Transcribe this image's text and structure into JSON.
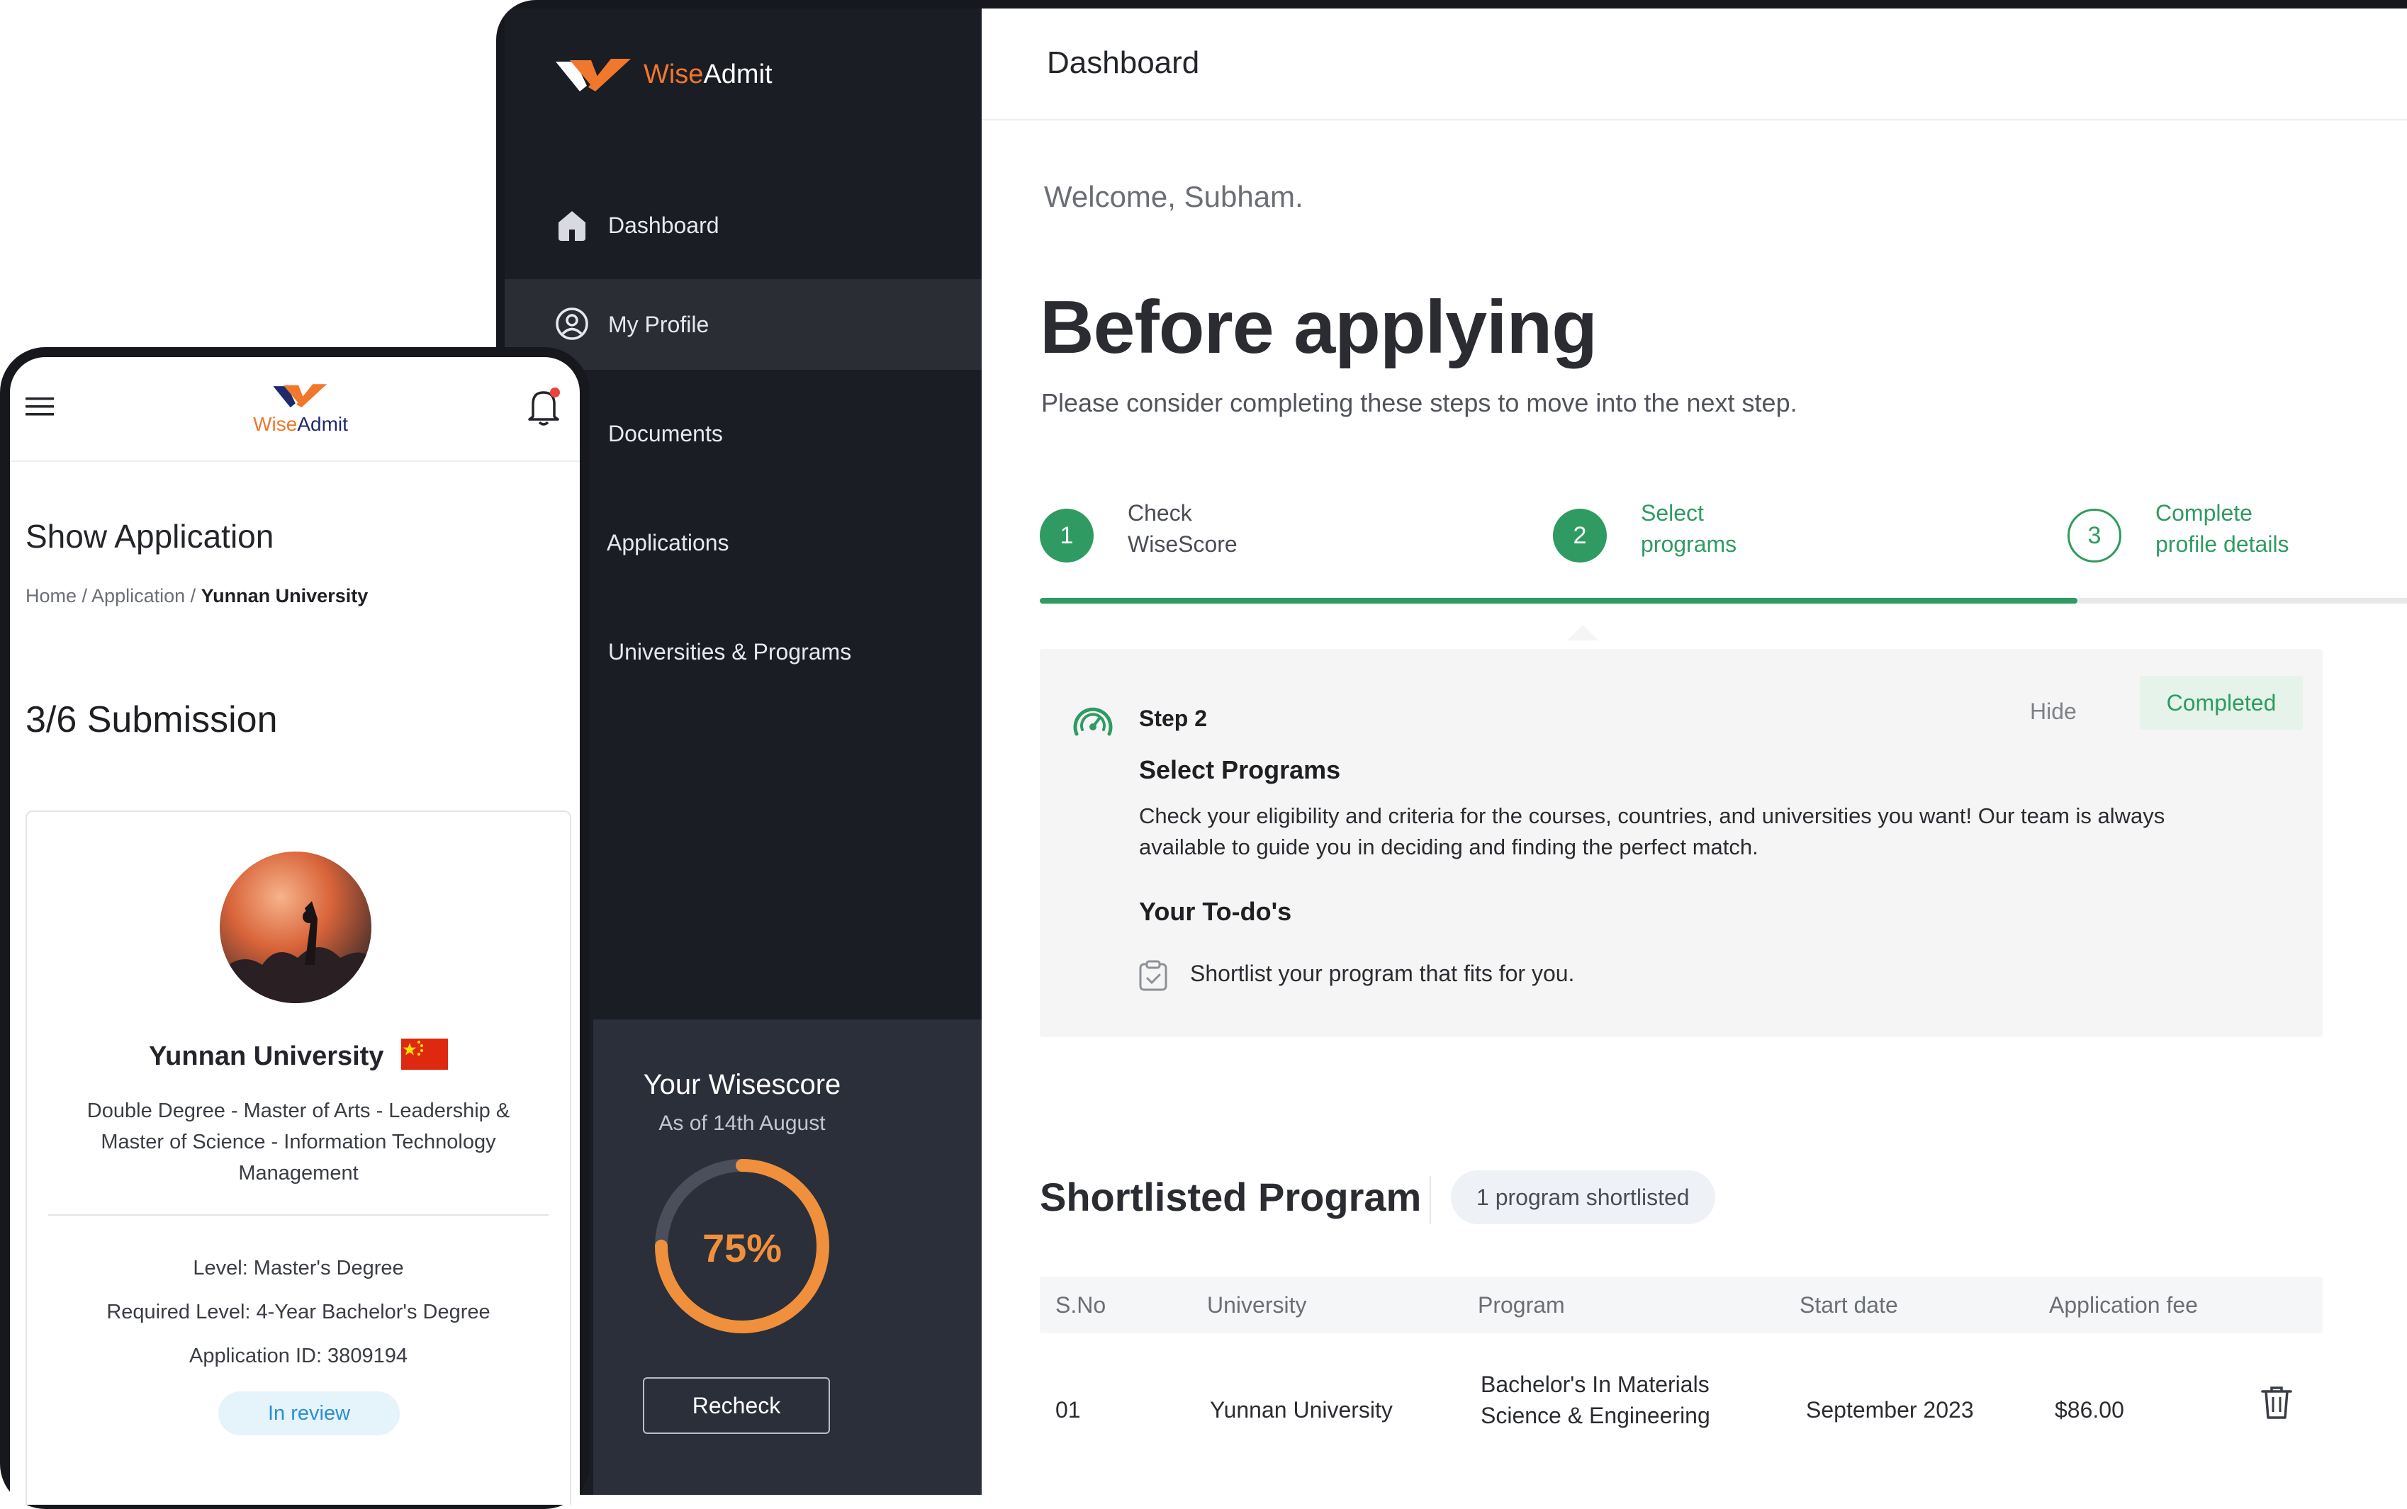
{
  "brand": {
    "name_part1": "Wise",
    "name_part2": "Admit",
    "orange": "#f0772c",
    "green": "#2f9b62"
  },
  "sidebar": {
    "items": [
      {
        "label": "Dashboard",
        "icon": "home-icon",
        "active": false
      },
      {
        "label": "My Profile",
        "icon": "user-circle-icon",
        "active": true
      },
      {
        "label": "Documents",
        "icon": "",
        "active": false
      },
      {
        "label": "Applications",
        "icon": "",
        "active": false
      },
      {
        "label": "Universities & Programs",
        "icon": "",
        "active": false
      }
    ],
    "wisescore": {
      "title": "Your Wisescore",
      "subtitle": "As of 14th August",
      "percent_label": "75%",
      "percent": 75,
      "button": "Recheck"
    }
  },
  "main": {
    "header_title": "Dashboard",
    "welcome": "Welcome, Subham.",
    "title": "Before applying",
    "subtitle": "Please consider completing these steps to move into the next step.",
    "steps": [
      {
        "number": "1",
        "line1": "Check",
        "line2": "WiseScore",
        "state": "done"
      },
      {
        "number": "2",
        "line1": "Select",
        "line2": "programs",
        "state": "current"
      },
      {
        "number": "3",
        "line1": "Complete",
        "line2": "profile details",
        "state": "todo"
      }
    ],
    "progress_fraction": 0.744,
    "step_card": {
      "step_label": "Step 2",
      "hide_label": "Hide",
      "badge": "Completed",
      "title": "Select Programs",
      "description": "Check your eligibility and criteria for the courses, countries, and universities you want! Our team is always available to guide you in deciding and finding the perfect match.",
      "todo_heading": "Your To-do's",
      "todo_item": "Shortlist your program that fits for you."
    },
    "shortlist": {
      "title": "Shortlisted Program",
      "pill": "1 program shortlisted",
      "columns": [
        "S.No",
        "University",
        "Program",
        "Start date",
        "Application fee"
      ],
      "rows": [
        {
          "sno": "01",
          "university": "Yunnan University",
          "program_line1": "Bachelor's In Materials",
          "program_line2": "Science & Engineering",
          "start": "September 2023",
          "fee": "$86.00"
        }
      ]
    }
  },
  "mobile": {
    "title": "Show Application",
    "breadcrumb": {
      "home": "Home /",
      "application": "Application /",
      "current": "Yunnan University"
    },
    "submission": "3/6 Submission",
    "card": {
      "university": "Yunnan University",
      "program": "Double Degree - Master of Arts - Leadership & Master of Science - Information Technology Management",
      "level": "Level: Master's Degree",
      "required_level": "Required Level: 4-Year Bachelor's Degree",
      "application_id": "Application ID: 3809194",
      "status": "In review"
    }
  }
}
